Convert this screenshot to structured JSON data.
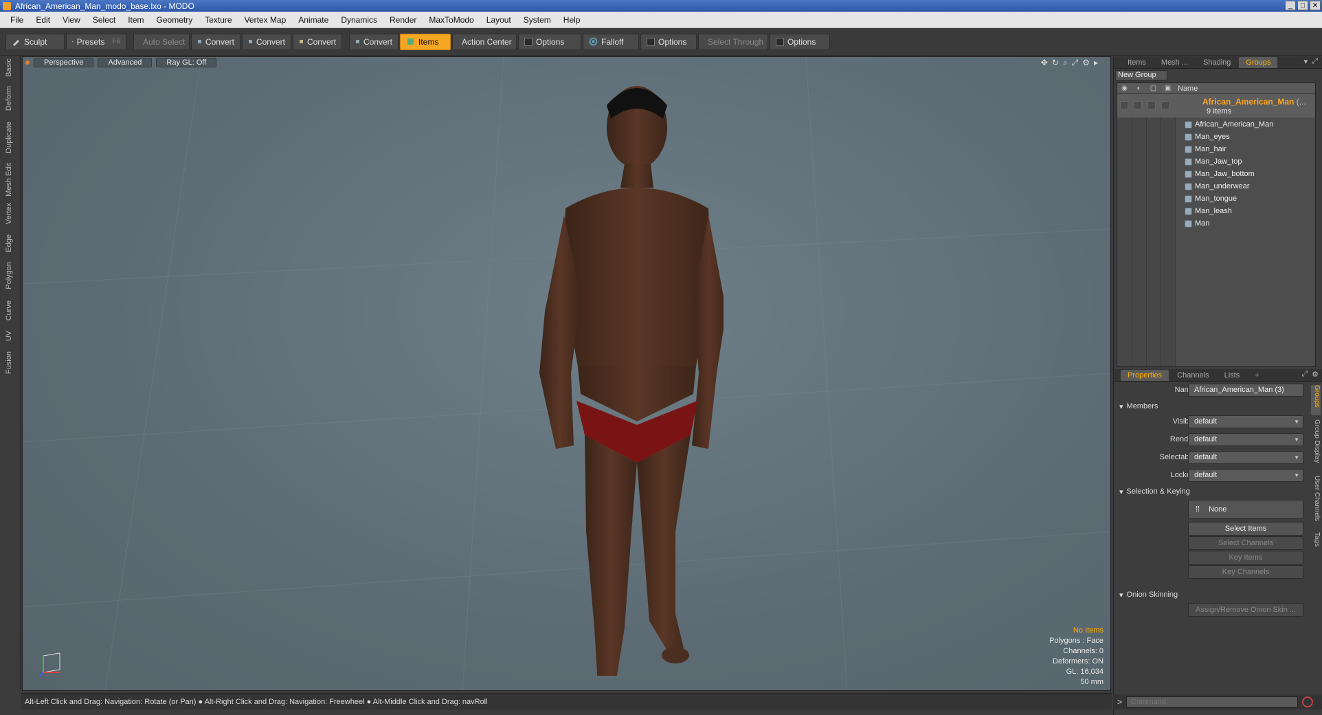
{
  "window": {
    "title": "African_American_Man_modo_base.lxo - MODO",
    "controls": [
      "_",
      "□",
      "✕"
    ]
  },
  "menu": [
    "File",
    "Edit",
    "View",
    "Select",
    "Item",
    "Geometry",
    "Texture",
    "Vertex Map",
    "Animate",
    "Dynamics",
    "Render",
    "MaxToModo",
    "Layout",
    "System",
    "Help"
  ],
  "toolbar": {
    "sculpt": "Sculpt",
    "presets": "Presets",
    "presets_key": "F6",
    "auto_select": "Auto Select",
    "convert": "Convert",
    "items": "Items",
    "action_center": "Action Center",
    "options": "Options",
    "falloff": "Falloff",
    "select_through": "Select Through"
  },
  "left_tabs": [
    "Basic",
    "Deform",
    "Duplicate",
    "Mesh Edit",
    "Vertex",
    "Edge",
    "Polygon",
    "Curve",
    "UV",
    "Fusion"
  ],
  "viewport": {
    "view_mode": "Perspective",
    "shading": "Advanced",
    "raygl": "Ray GL: Off",
    "info": {
      "selection": "No Items",
      "polygons": "Polygons : Face",
      "channels": "Channels: 0",
      "deformers": "Deformers: ON",
      "gl": "GL: 16,034",
      "focal": "50 mm"
    }
  },
  "status": "Alt-Left Click and Drag: Navigation: Rotate (or Pan) ● Alt-Right Click and Drag: Navigation: Freewheel ● Alt-Middle Click and Drag: navRoll",
  "groups_panel": {
    "tabs": [
      "Items",
      "Mesh ...",
      "Shading",
      "Groups"
    ],
    "new_group": "New Group",
    "name_header": "Name",
    "group": {
      "name": "African_American_Man",
      "name_suffix": "(...",
      "count": "9 Items"
    },
    "items": [
      "African_American_Man",
      "Man_eyes",
      "Man_hair",
      "Man_Jaw_top",
      "Man_Jaw_bottom",
      "Man_underwear",
      "Man_tongue",
      "Man_leash",
      "Man"
    ]
  },
  "properties": {
    "tabs": [
      "Properties",
      "Channels",
      "Lists",
      "+"
    ],
    "name_label": "Name",
    "name_value": "African_American_Man (3)",
    "members_section": "Members",
    "visible_label": "Visible",
    "render_label": "Render",
    "selectable_label": "Selectable",
    "locked_label": "Locked",
    "default_value": "default",
    "selection_section": "Selection & Keying",
    "none_label": "None",
    "select_items": "Select Items",
    "select_channels": "Select Channels",
    "key_items": "Key Items",
    "key_channels": "Key Channels",
    "onion_section": "Onion Skinning",
    "assign_onion": "Assign/Remove Onion Skin ..."
  },
  "side_vtabs": [
    "Groups",
    "Group Display",
    "User Channels",
    "Tags"
  ],
  "command": {
    "prompt": ">",
    "placeholder": "Command"
  },
  "colors": {
    "accent": "#f5a623",
    "group_name": "#ffa620",
    "viewport_bg": "#5d6c74"
  }
}
